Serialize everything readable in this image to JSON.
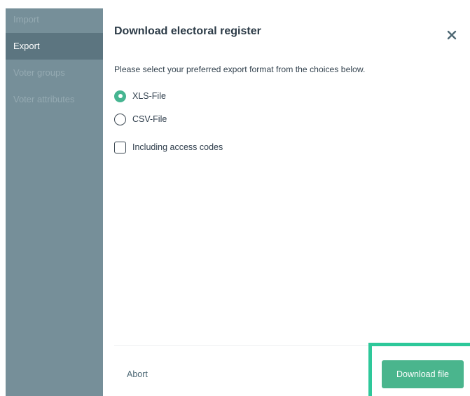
{
  "sidebar": {
    "items": [
      {
        "label": "Import"
      },
      {
        "label": "Export"
      },
      {
        "label": "Voter groups"
      },
      {
        "label": "Voter attributes"
      }
    ]
  },
  "dialog": {
    "title": "Download electoral register",
    "intro": "Please select your preferred export format from the choices below.",
    "format_options": [
      {
        "label": "XLS-File",
        "selected": true
      },
      {
        "label": "CSV-File",
        "selected": false
      }
    ],
    "include_access_codes": {
      "label": "Including access codes",
      "checked": false
    },
    "abort_label": "Abort",
    "download_label": "Download file"
  },
  "icons": {
    "close": "close-icon"
  },
  "colors": {
    "sidebar_bg": "#768f99",
    "sidebar_active_bg": "#5c7580",
    "accent": "#4ab58d",
    "highlight": "#2ec89a"
  }
}
